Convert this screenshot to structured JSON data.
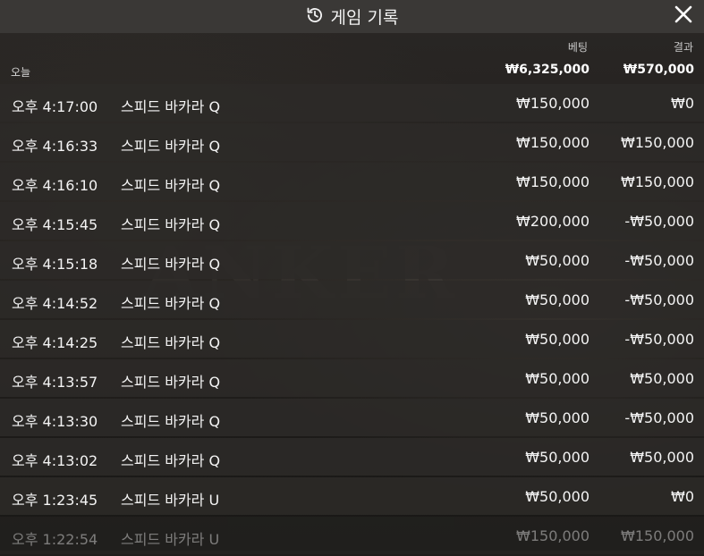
{
  "header": {
    "title": "게임 기록"
  },
  "columns": {
    "bet": "베팅",
    "result": "결과"
  },
  "summary": {
    "label": "오늘",
    "bet_total": "₩6,325,000",
    "result_total": "₩570,000"
  },
  "rows": [
    {
      "time": "오후 4:17:00",
      "game": "스피드 바카라 Q",
      "bet": "₩150,000",
      "result": "₩0"
    },
    {
      "time": "오후 4:16:33",
      "game": "스피드 바카라 Q",
      "bet": "₩150,000",
      "result": "₩150,000"
    },
    {
      "time": "오후 4:16:10",
      "game": "스피드 바카라 Q",
      "bet": "₩150,000",
      "result": "₩150,000"
    },
    {
      "time": "오후 4:15:45",
      "game": "스피드 바카라 Q",
      "bet": "₩200,000",
      "result": "-₩50,000"
    },
    {
      "time": "오후 4:15:18",
      "game": "스피드 바카라 Q",
      "bet": "₩50,000",
      "result": "-₩50,000"
    },
    {
      "time": "오후 4:14:52",
      "game": "스피드 바카라 Q",
      "bet": "₩50,000",
      "result": "-₩50,000"
    },
    {
      "time": "오후 4:14:25",
      "game": "스피드 바카라 Q",
      "bet": "₩50,000",
      "result": "-₩50,000"
    },
    {
      "time": "오후 4:13:57",
      "game": "스피드 바카라 Q",
      "bet": "₩50,000",
      "result": "₩50,000"
    },
    {
      "time": "오후 4:13:30",
      "game": "스피드 바카라 Q",
      "bet": "₩50,000",
      "result": "-₩50,000"
    },
    {
      "time": "오후 4:13:02",
      "game": "스피드 바카라 Q",
      "bet": "₩50,000",
      "result": "₩50,000"
    },
    {
      "time": "오후 1:23:45",
      "game": "스피드 바카라 U",
      "bet": "₩50,000",
      "result": "₩0"
    },
    {
      "time": "오후 1:22:54",
      "game": "스피드 바카라 U",
      "bet": "₩150,000",
      "result": "₩150,000"
    }
  ],
  "icons": {
    "history": "history-icon",
    "close": "close-icon"
  }
}
